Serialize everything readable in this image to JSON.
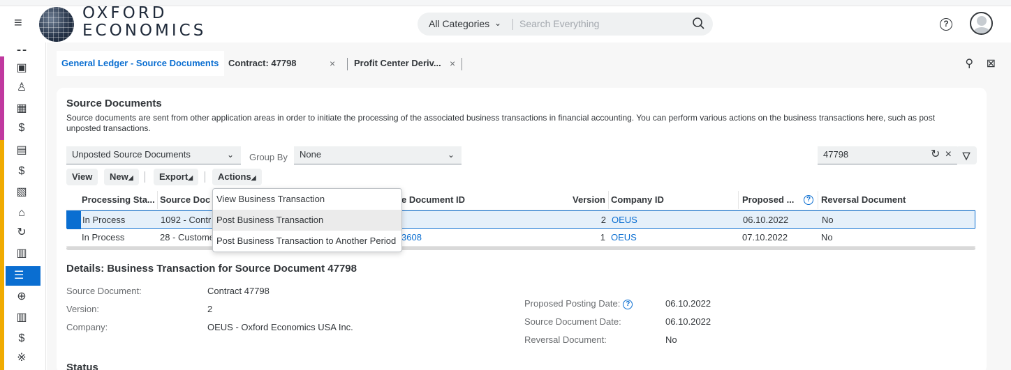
{
  "shell": {
    "logo_line1": "OXFORD",
    "logo_line2": "ECONOMICS",
    "category": "All Categories",
    "search_placeholder": "Search Everything",
    "help": "?"
  },
  "tabs": [
    {
      "label": "General Ledger - Source Documents"
    },
    {
      "label": "Contract: 47798",
      "close": "×"
    },
    {
      "label": "Profit Center Deriv...",
      "close": "×"
    }
  ],
  "section": {
    "title": "Source Documents",
    "description": "Source documents are sent from other application areas in order to initiate the processing of the associated business transactions in financial accounting. You can perform various actions on the business transactions here, such as post unposted transactions."
  },
  "filters": {
    "view_select": "Unposted Source Documents",
    "group_by_label": "Group By",
    "group_by_value": "None",
    "search_value": "47798"
  },
  "toolbar": {
    "view": "View",
    "new": "New",
    "export": "Export",
    "actions": "Actions"
  },
  "table": {
    "headers": {
      "processing_status": "Processing Sta...",
      "source_doc": "Source Doc",
      "source_doc_id": "e Document ID",
      "version": "Version",
      "company_id": "Company ID",
      "proposed": "Proposed ...",
      "reversal": "Reversal Document"
    },
    "rows": [
      {
        "status": "In Process",
        "source": "1092 - Contr",
        "doc_id": "",
        "version": "2",
        "company": "OEUS",
        "proposed": "06.10.2022",
        "reversal": "No"
      },
      {
        "status": "In Process",
        "source": "28 - Custome",
        "doc_id": "3608",
        "version": "1",
        "company": "OEUS",
        "proposed": "07.10.2022",
        "reversal": "No"
      }
    ]
  },
  "actions_menu": [
    "View Business Transaction",
    "Post Business Transaction",
    "Post Business Transaction to Another Period"
  ],
  "details": {
    "title": "Details: Business Transaction for Source Document 47798",
    "source_document_label": "Source Document:",
    "source_document_value": "Contract 47798",
    "version_label": "Version:",
    "version_value": "2",
    "company_label": "Company:",
    "company_value": "OEUS - Oxford Economics USA Inc.",
    "proposed_posting_label": "Proposed Posting Date:",
    "proposed_posting_value": "06.10.2022",
    "source_doc_date_label": "Source Document Date:",
    "source_doc_date_value": "06.10.2022",
    "reversal_label": "Reversal Document:",
    "reversal_value": "No"
  },
  "status_title": "Status",
  "colors": {
    "accent": "#0a6ed1",
    "rail_magenta": "#c0399f",
    "rail_yellow": "#f0ab00"
  }
}
